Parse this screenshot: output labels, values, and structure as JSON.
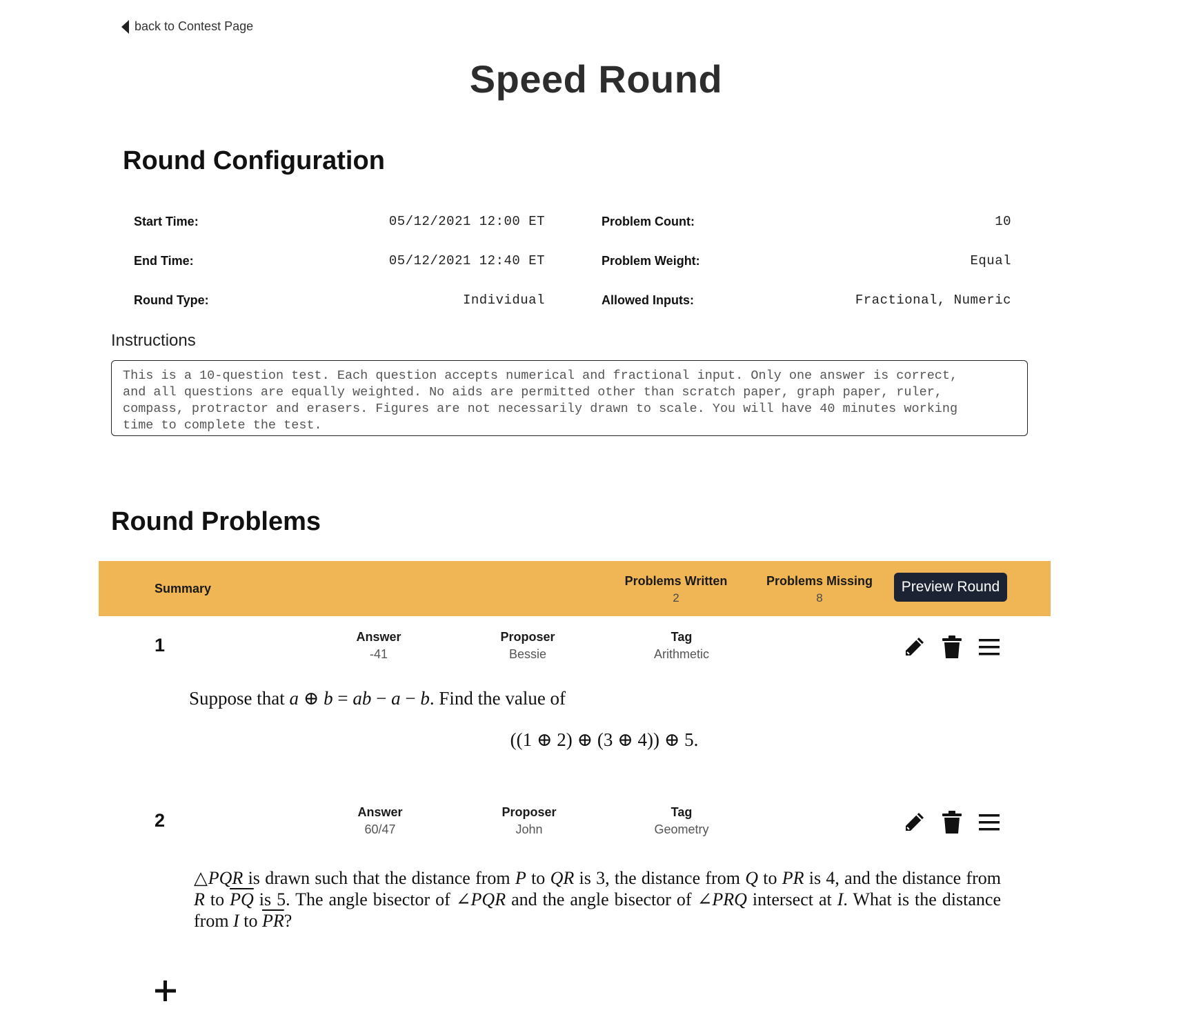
{
  "nav": {
    "back_label": "back to Contest Page",
    "back_icon": "caret-left-icon"
  },
  "page": {
    "title": "Speed Round"
  },
  "config": {
    "title": "Round Configuration",
    "start_time": {
      "label": "Start Time:",
      "value": "05/12/2021 12:00 ET"
    },
    "end_time": {
      "label": "End Time:",
      "value": "05/12/2021 12:40 ET"
    },
    "round_type": {
      "label": "Round Type:",
      "value": "Individual"
    },
    "problem_count": {
      "label": "Problem Count:",
      "value": "10"
    },
    "problem_weight": {
      "label": "Problem Weight:",
      "value": "Equal"
    },
    "allowed_inputs": {
      "label": "Allowed Inputs:",
      "value": "Fractional, Numeric"
    },
    "instructions_label": "Instructions",
    "instructions": "This is a 10-question test. Each question accepts numerical and fractional input. Only one answer is correct,\nand all questions are equally weighted. No aids are permitted other than scratch paper, graph paper, ruler,\ncompass, protractor and erasers. Figures are not necessarily drawn to scale. You will have 40 minutes working\ntime to complete the test."
  },
  "problems_section": {
    "title": "Round Problems",
    "summary": {
      "label": "Summary",
      "written_label": "Problems Written",
      "written_value": "2",
      "missing_label": "Problems Missing",
      "missing_value": "8",
      "preview_button": "Preview Round"
    },
    "meta_labels": {
      "answer": "Answer",
      "proposer": "Proposer",
      "tag": "Tag"
    },
    "problems": [
      {
        "number": "1",
        "answer": "-41",
        "proposer": "Bessie",
        "tag": "Arithmetic"
      },
      {
        "number": "2",
        "answer": "60/47",
        "proposer": "John",
        "tag": "Geometry"
      }
    ],
    "icons": [
      "pencil-icon",
      "trash-icon",
      "hamburger-menu-icon",
      "plus-icon"
    ],
    "accent_color": "#f0b655",
    "button_color": "#1c2433"
  },
  "problem_text": {
    "p1_line1": {
      "lead": "Suppose that ",
      "a": "a",
      "op": " ⊕ ",
      "b": "b",
      "eq": " = ",
      "ab": "ab",
      "minus1": " − ",
      "a2": "a",
      "minus2": " − ",
      "b2": "b",
      "tail": ". Find the value of"
    },
    "p1_display": "((1 ⊕ 2) ⊕ (3 ⊕ 4)) ⊕ 5.",
    "p2": {
      "s1": "△",
      "pqr": "PQR",
      "s2": " is drawn such that the distance from ",
      "p": "P",
      "s3": " to ",
      "qr": "QR",
      "s4": " is 3, the distance from ",
      "q": "Q",
      "s5": " to ",
      "pr": "PR",
      "s6": " is 4, and the distance from ",
      "r": "R",
      "s7": " to ",
      "pq_bar": "PQ",
      "s8": " is 5. The angle bisector of ∠",
      "pqr2": "PQR",
      "s9": " and the angle bisector of ∠",
      "prq": "PRQ",
      "s10": " intersect at ",
      "i": "I",
      "s11": ". What is the distance from ",
      "i2": "I",
      "s12": " to ",
      "pr_bar": "PR",
      "s13": "?"
    }
  }
}
